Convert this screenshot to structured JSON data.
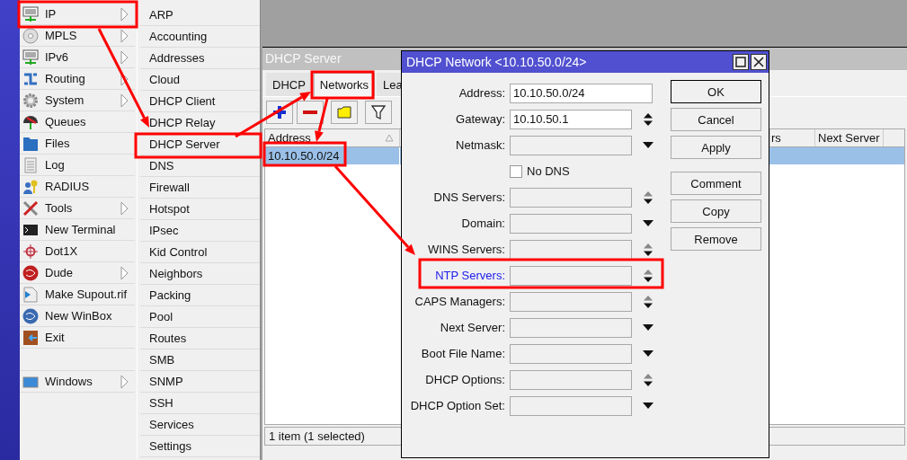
{
  "main_menu": {
    "items": [
      {
        "label": "IP",
        "has_submenu": true
      },
      {
        "label": "MPLS",
        "has_submenu": true
      },
      {
        "label": "IPv6",
        "has_submenu": true
      },
      {
        "label": "Routing",
        "has_submenu": true
      },
      {
        "label": "System",
        "has_submenu": true
      },
      {
        "label": "Queues",
        "has_submenu": false
      },
      {
        "label": "Files",
        "has_submenu": false
      },
      {
        "label": "Log",
        "has_submenu": false
      },
      {
        "label": "RADIUS",
        "has_submenu": false
      },
      {
        "label": "Tools",
        "has_submenu": true
      },
      {
        "label": "New Terminal",
        "has_submenu": false
      },
      {
        "label": "Dot1X",
        "has_submenu": false
      },
      {
        "label": "Dude",
        "has_submenu": true
      },
      {
        "label": "Make Supout.rif",
        "has_submenu": false
      },
      {
        "label": "New WinBox",
        "has_submenu": false
      },
      {
        "label": "Exit",
        "has_submenu": false
      }
    ],
    "bottom_items": [
      {
        "label": "Windows",
        "has_submenu": true
      }
    ]
  },
  "submenu": {
    "items": [
      "ARP",
      "Accounting",
      "Addresses",
      "Cloud",
      "DHCP Client",
      "DHCP Relay",
      "DHCP Server",
      "DNS",
      "Firewall",
      "Hotspot",
      "IPsec",
      "Kid Control",
      "Neighbors",
      "Packing",
      "Pool",
      "Routes",
      "SMB",
      "SNMP",
      "SSH",
      "Services",
      "Settings"
    ]
  },
  "server_window": {
    "title": "DHCP Server",
    "tabs": [
      {
        "label": "DHCP",
        "selected": false
      },
      {
        "label": "Networks",
        "selected": true
      },
      {
        "label": "Lea",
        "selected": false
      }
    ],
    "toolbar": [
      {
        "kind": "add"
      },
      {
        "kind": "remove"
      },
      {
        "kind": "comment"
      },
      {
        "kind": "filter"
      }
    ],
    "table": {
      "columns": [
        "Address",
        "rs",
        "Next Server"
      ],
      "rows": [
        {
          "cells": [
            "10.10.50.0/24"
          ],
          "selected": true
        }
      ]
    },
    "status_bar": "1 item (1 selected)"
  },
  "dialog": {
    "title": "DHCP Network <10.10.50.0/24>",
    "fields": [
      {
        "label": "Address:",
        "kind": "text",
        "value": "10.10.50.0/24",
        "disabled": false,
        "highlighted": false
      },
      {
        "label": "Gateway:",
        "kind": "spinner",
        "value": "10.10.50.1",
        "disabled": false,
        "highlighted": false
      },
      {
        "label": "Netmask:",
        "kind": "dropdown",
        "disabled": true,
        "highlighted": false
      },
      {
        "label": "No DNS",
        "kind": "checkbox",
        "checked": false,
        "disabled": false,
        "highlighted": false
      },
      {
        "label": "DNS Servers:",
        "kind": "spinner",
        "disabled": true,
        "highlighted": false
      },
      {
        "label": "Domain:",
        "kind": "dropdown",
        "disabled": true,
        "highlighted": false
      },
      {
        "label": "WINS Servers:",
        "kind": "spinner",
        "disabled": true,
        "highlighted": false
      },
      {
        "label": "NTP Servers:",
        "kind": "spinner",
        "disabled": true,
        "highlighted": true
      },
      {
        "label": "CAPS Managers:",
        "kind": "spinner",
        "disabled": true,
        "highlighted": false
      },
      {
        "label": "Next Server:",
        "kind": "dropdown",
        "disabled": true,
        "highlighted": false
      },
      {
        "label": "Boot File Name:",
        "kind": "dropdown",
        "disabled": true,
        "highlighted": false
      },
      {
        "label": "DHCP Options:",
        "kind": "spinner",
        "disabled": true,
        "highlighted": false
      },
      {
        "label": "DHCP Option Set:",
        "kind": "dropdown",
        "disabled": true,
        "highlighted": false
      }
    ],
    "buttons": [
      {
        "label": "OK",
        "default": true
      },
      {
        "label": "Cancel",
        "default": false
      },
      {
        "label": "Apply",
        "default": false
      }
    ],
    "item_buttons": [
      {
        "label": "Comment",
        "default": false
      },
      {
        "label": "Copy",
        "default": false
      },
      {
        "label": "Remove",
        "default": false
      }
    ]
  }
}
